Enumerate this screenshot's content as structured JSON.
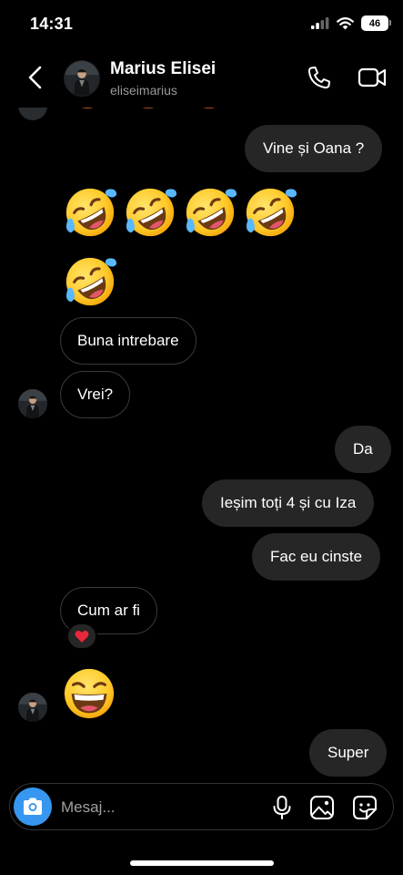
{
  "status_bar": {
    "time": "14:31",
    "battery": "46",
    "icons": [
      "signal-icon",
      "wifi-icon",
      "battery-icon"
    ]
  },
  "header": {
    "name": "Marius Elisei",
    "handle": "eliseimarius",
    "icons": [
      "back-chevron-icon",
      "avatar",
      "phone-icon",
      "video-camera-icon"
    ]
  },
  "messages": [
    {
      "side": "out",
      "text": "Vine și Oana ?"
    },
    {
      "side": "in",
      "emoji": "rolling-on-floor-laughing",
      "count": 4
    },
    {
      "side": "in",
      "emoji": "rolling-on-floor-laughing",
      "count": 1
    },
    {
      "side": "in",
      "text": "Buna intrebare"
    },
    {
      "side": "in",
      "text": "Vrei?"
    },
    {
      "side": "out",
      "text": "Da"
    },
    {
      "side": "out",
      "text": "Ieșim toți 4 și cu Iza"
    },
    {
      "side": "out",
      "text": "Fac eu cinste"
    },
    {
      "side": "in",
      "text": "Cum ar fi",
      "reaction": "red-heart"
    },
    {
      "side": "in",
      "emoji": "grinning-squinting-face",
      "count": 1
    },
    {
      "side": "out",
      "text": "Super"
    }
  ],
  "composer": {
    "placeholder": "Mesaj...",
    "icons": [
      "camera-icon",
      "microphone-icon",
      "gallery-icon",
      "sticker-icon"
    ]
  },
  "colors": {
    "background": "#000000",
    "outgoing_bubble": "#262626",
    "incoming_border": "#3a3a3a",
    "accent": "#3797f0",
    "muted_text": "#9a9a9a"
  }
}
